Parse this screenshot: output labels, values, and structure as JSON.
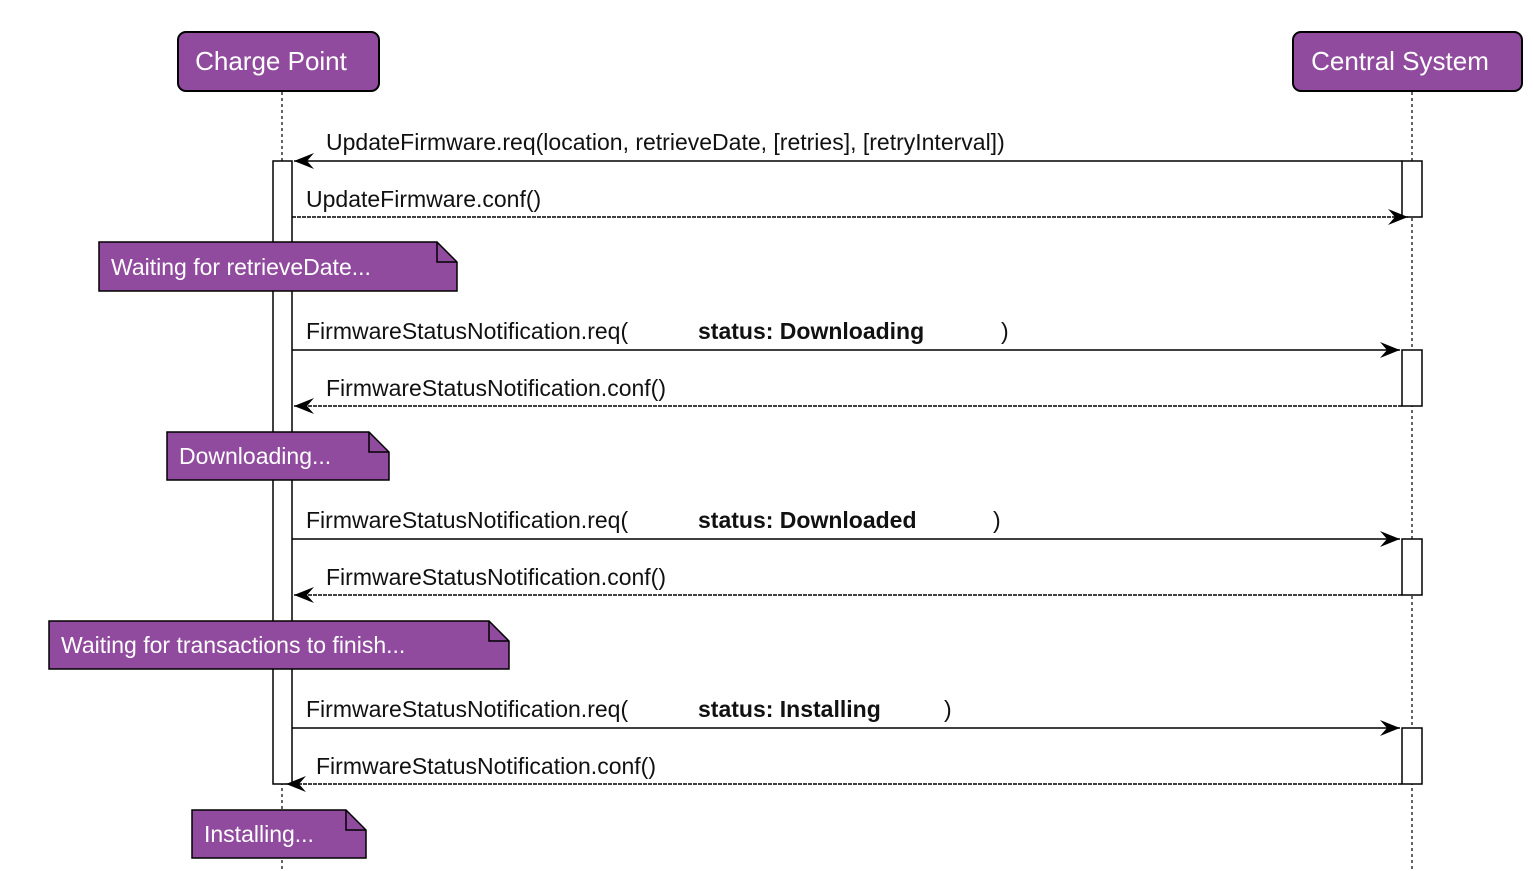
{
  "colors": {
    "participant_fill": "#904b9e",
    "note_fill": "#904b9e",
    "line": "#000000",
    "activation_fill": "#ffffff"
  },
  "participants": {
    "charge_point": "Charge Point",
    "central_system": "Central System"
  },
  "messages": {
    "update_firmware_req": "UpdateFirmware.req(location, retrieveDate, [retries], [retryInterval])",
    "update_firmware_conf": "UpdateFirmware.conf()",
    "fsn_req_downloading": {
      "prefix": "FirmwareStatusNotification.req(",
      "status": "status: Downloading",
      "suffix": ")"
    },
    "fsn_conf_1": "FirmwareStatusNotification.conf()",
    "fsn_req_downloaded": {
      "prefix": "FirmwareStatusNotification.req(",
      "status": "status: Downloaded",
      "suffix": ")"
    },
    "fsn_conf_2": "FirmwareStatusNotification.conf()",
    "fsn_req_installing": {
      "prefix": "FirmwareStatusNotification.req(",
      "status": "status: Installing",
      "suffix": ")"
    },
    "fsn_conf_3": "FirmwareStatusNotification.conf()"
  },
  "notes": {
    "waiting_retrieve": "Waiting for retrieveDate...",
    "downloading": "Downloading...",
    "waiting_transactions": "Waiting for transactions to finish...",
    "installing": "Installing..."
  }
}
